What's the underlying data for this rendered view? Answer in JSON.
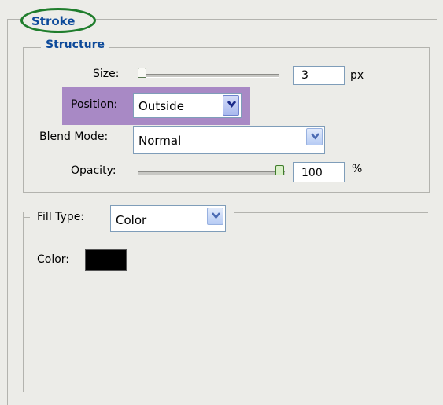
{
  "stroke_panel": {
    "title": "Stroke",
    "structure": {
      "title": "Structure",
      "size": {
        "label": "Size:",
        "value": "3",
        "unit": "px",
        "slider_level": 0.0
      },
      "position": {
        "label": "Position:",
        "selected": "Outside"
      },
      "blend_mode": {
        "label": "Blend Mode:",
        "selected": "Normal"
      },
      "opacity": {
        "label": "Opacity:",
        "value": "100",
        "unit": "%",
        "slider_level": 1.0
      }
    },
    "fill": {
      "label": "Fill Type:",
      "selected": "Color",
      "color_label": "Color:",
      "color_value": "#000000"
    }
  },
  "colors": {
    "title_blue": "#0d4a9a",
    "highlight_green": "#1f7d2c",
    "position_highlight_purple": "#a889c5"
  },
  "icons": [
    "chevron-down-icon",
    "slider-thumb-icon"
  ]
}
